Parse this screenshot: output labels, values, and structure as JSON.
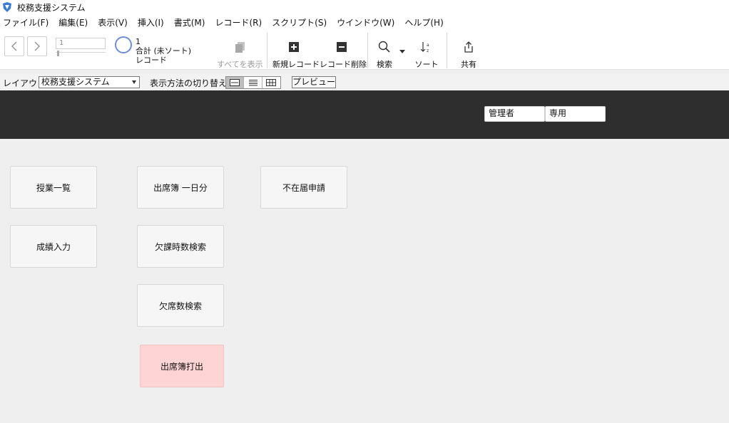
{
  "window": {
    "title": "校務支援システム"
  },
  "menubar": {
    "items": [
      "ファイル(F)",
      "編集(E)",
      "表示(V)",
      "挿入(I)",
      "書式(M)",
      "レコード(R)",
      "スクリプト(S)",
      "ウインドウ(W)",
      "ヘルプ(H)"
    ]
  },
  "toolbar": {
    "record_field": "1",
    "record_count": "1",
    "total_label": "合計 (未ソート)",
    "records_label": "レコード",
    "show_all": "すべてを表示",
    "new_record": "新規レコード",
    "delete_record": "レコード削除",
    "find": "検索",
    "sort": "ソート",
    "share": "共有"
  },
  "layoutbar": {
    "layout_label": "レイアウト:",
    "layout_value": "校務支援システム",
    "view_label": "表示方法の切り替え:",
    "preview": "プレビュー"
  },
  "header": {
    "field_admin": "管理者",
    "field_exclusive": "専用"
  },
  "buttons": {
    "class_list": "授業一覧",
    "attendance_day": "出席簿 一日分",
    "absence_request": "不在届申請",
    "grade_entry": "成績入力",
    "absence_hours_search": "欠課時数検索",
    "absence_count_search": "欠席数検索",
    "attendance_print": "出席簿打出"
  },
  "colors": {
    "header_band": "#2e2e2e",
    "print_button": "#ffd4d4",
    "pie_icon": "#6b8fd6"
  }
}
